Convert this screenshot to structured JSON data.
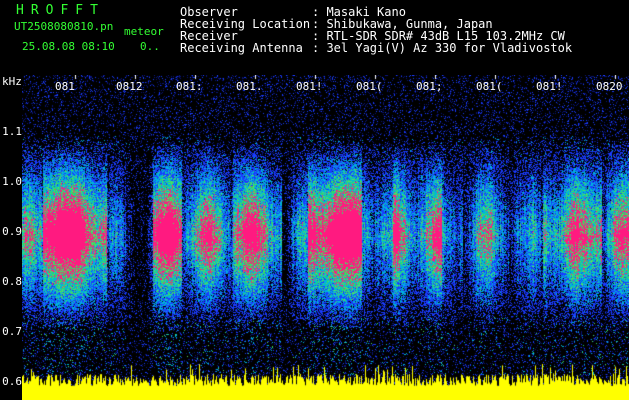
{
  "header": {
    "brand": "HROFFT",
    "filename": "UT2508080810.pn",
    "mode": "meteor",
    "datetime": "25.08.08 08:10",
    "counter": "0..",
    "info": [
      {
        "label": "Observer",
        "value": ": Masaki Kano"
      },
      {
        "label": "Receiving Location",
        "value": ": Shibukawa, Gunma, Japan"
      },
      {
        "label": "Receiver",
        "value": ": RTL-SDR SDR# 43dB L15 103.2MHz CW"
      },
      {
        "label": "Receiving Antenna",
        "value": ": 3el Yagi(V) Az 330 for Vladivostok"
      }
    ]
  },
  "axis": {
    "unit": "kHz",
    "yticks": [
      "1.1",
      "1.0",
      "0.9",
      "0.8",
      "0.7",
      "0.6"
    ],
    "time_labels": [
      "081",
      "0812",
      "081:",
      "081.",
      "081!",
      "081(",
      "081;",
      "081(",
      "081!",
      "0820"
    ]
  },
  "colors": {
    "background": "#000000",
    "text": "#ffffff",
    "brand": "#33ff33",
    "signal_strong": "#ff1a80",
    "signal_mid": "#22dd66",
    "signal_low": "#1a3cff",
    "baseline": "#ffff00"
  }
}
